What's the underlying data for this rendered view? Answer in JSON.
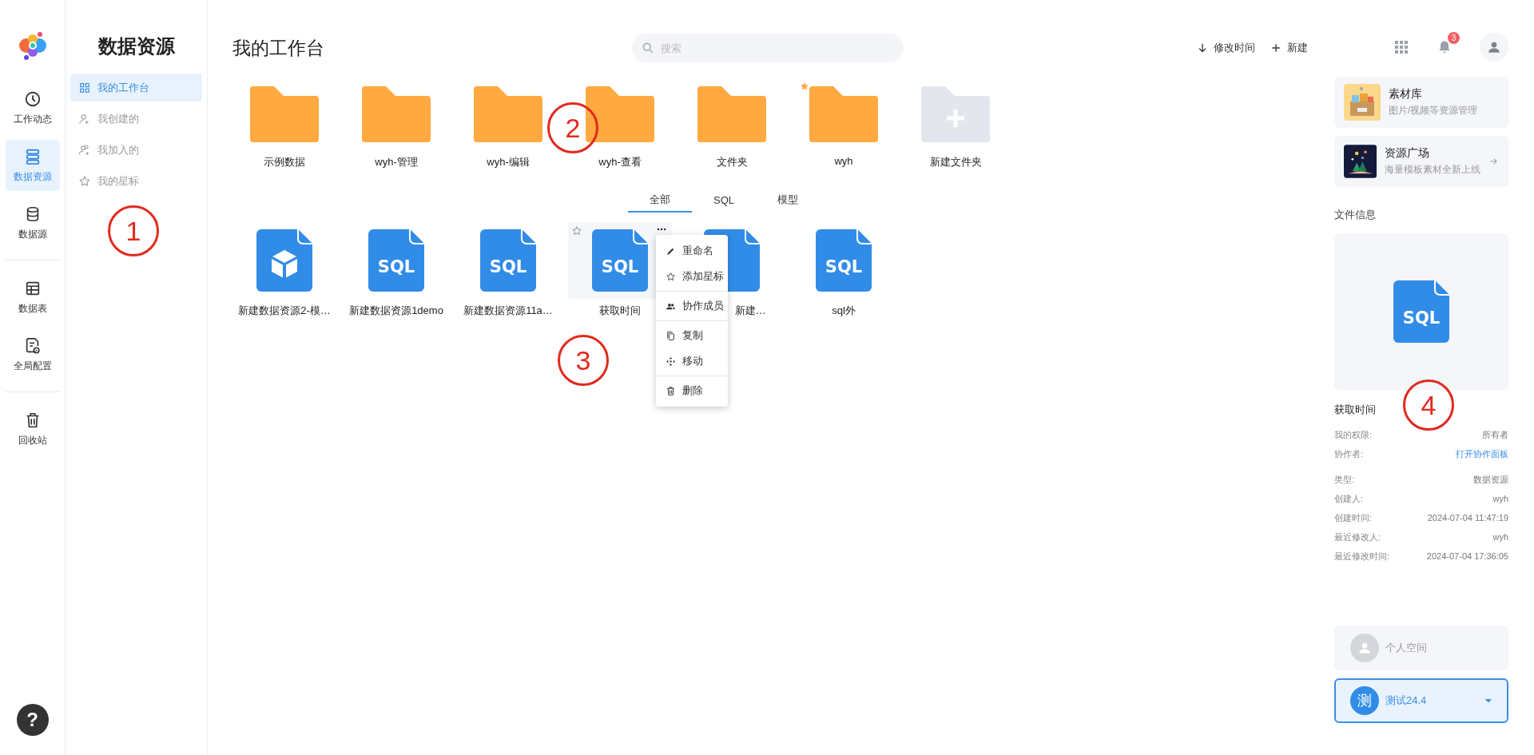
{
  "rail": {
    "groups": [
      [
        {
          "label": "工作动态",
          "kind": "clock",
          "selected": false
        },
        {
          "label": "数据资源",
          "kind": "stack",
          "selected": true
        },
        {
          "label": "数据源",
          "kind": "database",
          "selected": false
        }
      ],
      [
        {
          "label": "数据表",
          "kind": "table",
          "selected": false
        },
        {
          "label": "全局配置",
          "kind": "config",
          "selected": false
        }
      ],
      [
        {
          "label": "回收站",
          "kind": "trash",
          "selected": false
        }
      ]
    ],
    "help": "?"
  },
  "sidebar": {
    "title": "数据资源",
    "items": [
      {
        "label": "我的工作台",
        "kind": "grid",
        "selected": true
      },
      {
        "label": "我创建的",
        "kind": "user-add",
        "selected": false
      },
      {
        "label": "我加入的",
        "kind": "users",
        "selected": false
      },
      {
        "label": "我的星标",
        "kind": "star",
        "selected": false
      }
    ]
  },
  "main": {
    "title": "我的工作台",
    "search": {
      "placeholder": "搜索"
    },
    "actions": [
      {
        "kind": "sort",
        "label": "修改时间"
      },
      {
        "kind": "add",
        "label": "新建"
      }
    ],
    "folders": [
      {
        "name": "示例数据",
        "kind": "folder",
        "starred": false
      },
      {
        "name": "wyh-管理",
        "kind": "folder",
        "starred": false
      },
      {
        "name": "wyh-编辑",
        "kind": "folder",
        "starred": false
      },
      {
        "name": "wyh-查看",
        "kind": "folder",
        "starred": false
      },
      {
        "name": "文件夹",
        "kind": "folder",
        "starred": false
      },
      {
        "name": "wyh",
        "kind": "folder",
        "starred": true
      },
      {
        "name": "新建文件夹",
        "kind": "new",
        "starred": false
      }
    ],
    "tabs": [
      {
        "label": "全部",
        "selected": true
      },
      {
        "label": "SQL",
        "selected": false
      },
      {
        "label": "模型",
        "selected": false
      }
    ],
    "files": [
      {
        "name": "新建数据资源2-模…",
        "kind": "model",
        "selected": false
      },
      {
        "name": "新建数据资源1demo",
        "kind": "sql",
        "icon_text": "SQL",
        "selected": false
      },
      {
        "name": "新建数据资源11a…",
        "kind": "sql",
        "icon_text": "SQL",
        "selected": false
      },
      {
        "name": "获取时间",
        "kind": "sql",
        "icon_text": "SQL",
        "selected": true
      },
      {
        "name": "新建…",
        "kind": "sql",
        "selected": false
      },
      {
        "name": "sql外",
        "kind": "sql",
        "icon_text": "SQL",
        "selected": false
      }
    ],
    "context_menu": {
      "groups": [
        [
          {
            "kind": "pencil",
            "label": "重命名"
          },
          {
            "kind": "star",
            "label": "添加星标"
          }
        ],
        [
          {
            "kind": "members",
            "label": "协作成员"
          }
        ],
        [
          {
            "kind": "copy",
            "label": "复制"
          },
          {
            "kind": "move",
            "label": "移动"
          }
        ],
        [
          {
            "kind": "trash",
            "label": "删除"
          }
        ]
      ]
    }
  },
  "topbar": {
    "notifications": "3"
  },
  "right_panel": {
    "cards": [
      {
        "kind": "materials",
        "title": "素材库",
        "subtitle": "图片/视频等资源管理",
        "arrow": false
      },
      {
        "kind": "plaza",
        "title": "资源广场",
        "subtitle": "海量模板素材全新上线",
        "arrow": true
      }
    ],
    "file_info": {
      "heading": "文件信息",
      "preview": {
        "kind": "sql",
        "icon_text": "SQL"
      },
      "name": "获取时间",
      "permission_rows": [
        {
          "label": "我的权限:",
          "value": "所有者",
          "kind": "text"
        },
        {
          "label": "协作者:",
          "value": "打开协作面板",
          "kind": "link"
        }
      ],
      "detail_rows": [
        {
          "label": "类型:",
          "value": "数据资源",
          "kind": "text"
        },
        {
          "label": "创建人:",
          "value": "wyh",
          "kind": "text"
        },
        {
          "label": "创建时间:",
          "value": "2024-07-04 11:47:19",
          "kind": "text"
        },
        {
          "label": "最近修改人:",
          "value": "wyh",
          "kind": "text"
        },
        {
          "label": "最近修改时间:",
          "value": "2024-07-04 17:36:05",
          "kind": "text"
        }
      ]
    },
    "spaces": [
      {
        "kind": "personal",
        "label": "个人空间",
        "selected": false
      },
      {
        "kind": "team",
        "avatar": "测",
        "label": "测试24.4",
        "selected": true
      }
    ]
  },
  "annotations": [
    {
      "label": "1"
    },
    {
      "label": "2"
    },
    {
      "label": "3"
    },
    {
      "label": "4"
    }
  ]
}
